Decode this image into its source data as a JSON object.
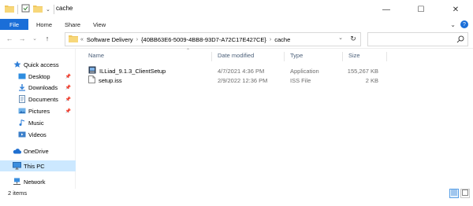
{
  "window": {
    "title": "cache",
    "minimize_glyph": "—",
    "maximize_glyph": "☐",
    "close_glyph": "✕"
  },
  "ribbon": {
    "tabs": [
      "File",
      "Home",
      "Share",
      "View"
    ],
    "expand_glyph": "⌄",
    "help_glyph": "?"
  },
  "navigation": {
    "back_glyph": "←",
    "forward_glyph": "→",
    "recent_glyph": "⌄",
    "up_glyph": "↑",
    "overflow_glyph": "«",
    "path": [
      "Software Delivery",
      "{40BB63E6-5009-4BB8-93D7-A72C17E427CE}",
      "cache"
    ],
    "separator": "›",
    "refresh_glyph": "↻",
    "search_placeholder": ""
  },
  "sidebar": {
    "items": [
      {
        "label": "Quick access",
        "icon": "star-icon",
        "pinned": false,
        "selected": false
      },
      {
        "label": "Desktop",
        "icon": "desktop-icon",
        "pinned": true,
        "selected": false
      },
      {
        "label": "Downloads",
        "icon": "download-icon",
        "pinned": true,
        "selected": false
      },
      {
        "label": "Documents",
        "icon": "documents-icon",
        "pinned": true,
        "selected": false
      },
      {
        "label": "Pictures",
        "icon": "pictures-icon",
        "pinned": true,
        "selected": false
      },
      {
        "label": "Music",
        "icon": "music-icon",
        "pinned": false,
        "selected": false
      },
      {
        "label": "Videos",
        "icon": "videos-icon",
        "pinned": false,
        "selected": false
      },
      {
        "label": "OneDrive",
        "icon": "cloud-icon",
        "pinned": false,
        "selected": false
      },
      {
        "label": "This PC",
        "icon": "computer-icon",
        "pinned": false,
        "selected": true
      },
      {
        "label": "Network",
        "icon": "network-icon",
        "pinned": false,
        "selected": false
      }
    ],
    "pin_glyph": "📌"
  },
  "file_list": {
    "columns": [
      "Name",
      "Date modified",
      "Type",
      "Size"
    ],
    "sort_glyph": "⌃",
    "rows": [
      {
        "name": "ILLiad_9.1.3_ClientSetup",
        "date": "4/7/2021 4:36 PM",
        "type": "Application",
        "size": "155,267 KB",
        "icon": "installer-icon"
      },
      {
        "name": "setup.iss",
        "date": "2/9/2022 12:36 PM",
        "type": "ISS File",
        "size": "2 KB",
        "icon": "file-icon"
      }
    ]
  },
  "status": {
    "item_count": "2 items"
  },
  "colors": {
    "accent": "#1a6ed8",
    "selected_bg": "#cce8ff",
    "folder": "#f0c75e"
  }
}
